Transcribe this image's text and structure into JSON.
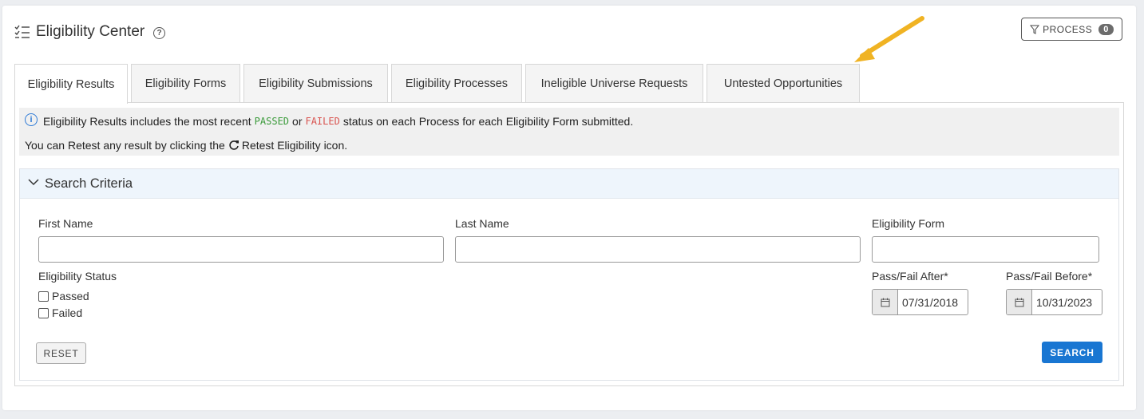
{
  "header": {
    "title": "Eligibility Center",
    "help_icon": "question-circle-icon",
    "list_icon": "checklist-icon",
    "process_button": {
      "label": "PROCESS",
      "count": "0",
      "icon": "filter-icon"
    }
  },
  "annotation": {
    "arrow_color": "#f0b323"
  },
  "tabs": [
    {
      "label": "Eligibility Results",
      "active": true
    },
    {
      "label": "Eligibility Forms",
      "active": false
    },
    {
      "label": "Eligibility Submissions",
      "active": false
    },
    {
      "label": "Eligibility Processes",
      "active": false
    },
    {
      "label": "Ineligible Universe Requests",
      "active": false
    },
    {
      "label": "Untested Opportunities",
      "active": false
    }
  ],
  "info": {
    "line1_pre": "Eligibility Results includes the most recent",
    "passed": "PASSED",
    "or": "or",
    "failed": "FAILED",
    "line1_post": "status on each Process for each Eligibility Form submitted.",
    "line2_pre": "You can Retest any result by clicking the",
    "line2_post": "Retest Eligibility icon."
  },
  "search_criteria": {
    "title": "Search Criteria",
    "first_name_label": "First Name",
    "first_name_value": "",
    "last_name_label": "Last Name",
    "last_name_value": "",
    "eligibility_form_label": "Eligibility Form",
    "eligibility_form_value": "",
    "status_label": "Eligibility Status",
    "status_options": [
      "Passed",
      "Failed"
    ],
    "after_label": "Pass/Fail After*",
    "after_value": "07/31/2018",
    "before_label": "Pass/Fail Before*",
    "before_value": "10/31/2023",
    "reset_label": "RESET",
    "search_label": "SEARCH"
  },
  "colors": {
    "primary": "#1976d2",
    "passed": "#3a9a3a",
    "failed": "#d9534f",
    "info": "#2f7bd6"
  }
}
